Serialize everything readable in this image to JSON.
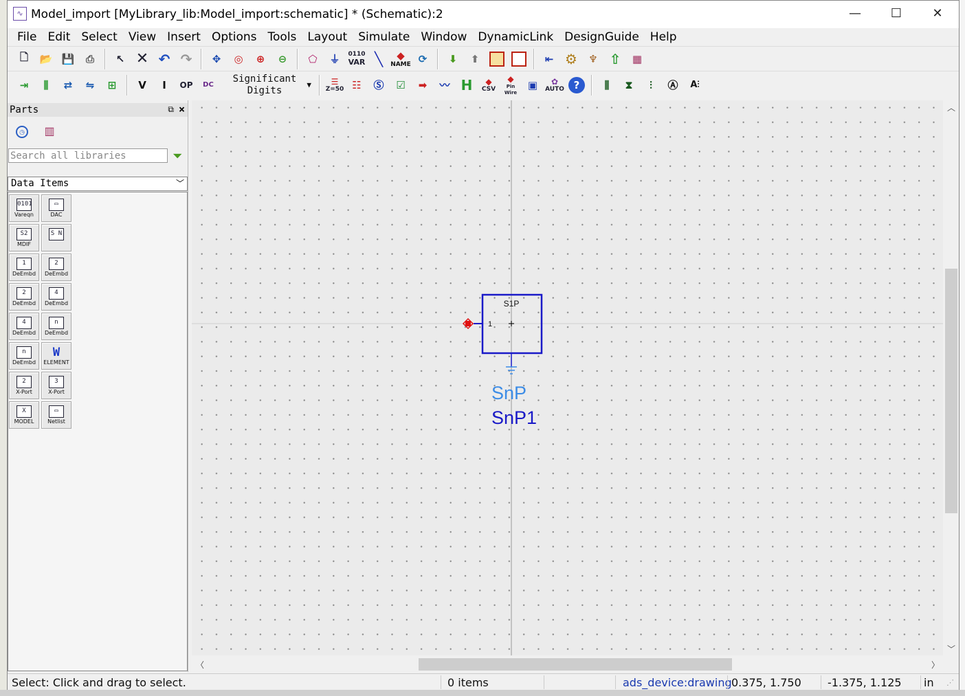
{
  "window": {
    "title": "Model_import [MyLibrary_lib:Model_import:schematic] * (Schematic):2",
    "minimize": "—",
    "maximize": "☐",
    "close": "✕"
  },
  "menu": [
    "File",
    "Edit",
    "Select",
    "View",
    "Insert",
    "Options",
    "Tools",
    "Layout",
    "Simulate",
    "Window",
    "DynamicLink",
    "DesignGuide",
    "Help"
  ],
  "toolbar": {
    "significant_digits_line1": "Significant",
    "significant_digits_line2": "Digits",
    "var_label": "VAR",
    "var_top": "0110",
    "name_label": "NAME",
    "z50": "Z=50",
    "csv": "CSV",
    "pinwire": "Pin Wire",
    "auto": "AUTO",
    "h_label": "H",
    "v_label": "V",
    "i_label": "I",
    "op_label": "OP",
    "dc_label": "DC"
  },
  "parts_panel": {
    "title": "Parts",
    "search_placeholder": "Search all libraries",
    "library": "Data Items",
    "items": [
      {
        "glyph": "0101",
        "label": "Vareqn"
      },
      {
        "glyph": "▭",
        "label": "DAC"
      },
      {
        "glyph": "S2",
        "label": "MDIF"
      },
      {
        "glyph": "S N",
        "label": ""
      },
      {
        "glyph": "1",
        "label": "DeEmbd"
      },
      {
        "glyph": "2",
        "label": "DeEmbd"
      },
      {
        "glyph": "2",
        "label": "DeEmbd"
      },
      {
        "glyph": "4",
        "label": "DeEmbd"
      },
      {
        "glyph": "4",
        "label": "DeEmbd"
      },
      {
        "glyph": "n",
        "label": "DeEmbd"
      },
      {
        "glyph": "n",
        "label": "DeEmbd"
      },
      {
        "glyph": "W",
        "label": "ELEMENT"
      },
      {
        "glyph": "2",
        "label": "X-Port"
      },
      {
        "glyph": "3",
        "label": "X-Port"
      },
      {
        "glyph": "X",
        "label": "MODEL"
      },
      {
        "glyph": "▭",
        "label": "Netlist"
      }
    ]
  },
  "schematic": {
    "component_type": "S1P",
    "pin_number": "1",
    "instance_type": "SnP",
    "instance_name": "SnP1",
    "colors": {
      "box": "#1a1ac8",
      "type_text": "#3c8ce6",
      "name_text": "#1a1ac8",
      "pin": "#e01010"
    }
  },
  "status": {
    "message": "Select: Click and drag to select.",
    "items": "0 items",
    "layer": "ads_device:drawing",
    "coord1": "0.375, 1.750",
    "coord2": "-1.375, 1.125",
    "units": "in"
  }
}
